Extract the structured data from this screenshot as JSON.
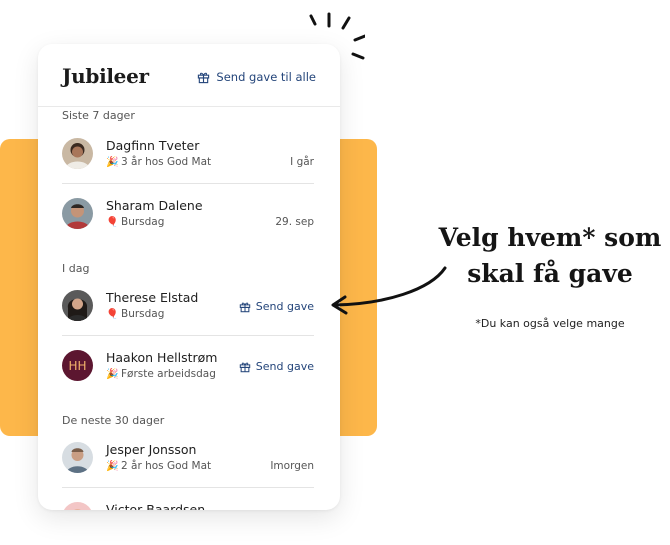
{
  "card": {
    "title": "Jubileer",
    "send_all_label": "Send gave til alle"
  },
  "sections": [
    {
      "label": "Siste 7 dager",
      "rows": [
        {
          "name": "Dagfinn Tveter",
          "event": "3 år hos God Mat",
          "event_icon": "party-popper-icon",
          "meta": "I går"
        },
        {
          "name": "Sharam Dalene",
          "event": "Bursdag",
          "event_icon": "balloon-icon",
          "meta": "29. sep"
        }
      ]
    },
    {
      "label": "I dag",
      "rows": [
        {
          "name": "Therese Elstad",
          "event": "Bursdag",
          "event_icon": "balloon-icon",
          "action": "Send gave"
        },
        {
          "name": "Haakon Hellstrøm",
          "initials": "HH",
          "event": "Første arbeidsdag",
          "event_icon": "party-popper-icon",
          "action": "Send gave"
        }
      ]
    },
    {
      "label": "De neste 30 dager",
      "rows": [
        {
          "name": "Jesper Jonsson",
          "event": "2 år hos God Mat",
          "event_icon": "party-popper-icon",
          "meta": "Imorgen"
        },
        {
          "name": "Victor Baardsen"
        }
      ]
    }
  ],
  "headline": {
    "line1": "Velg hvem* som",
    "line2": "skal få gave"
  },
  "footnote": "*Du kan også velge mange",
  "colors": {
    "accent_yellow": "#fdb74a",
    "link_blue": "#24457a",
    "initials_bg": "#5c1630",
    "initials_fg": "#f1b26b"
  }
}
